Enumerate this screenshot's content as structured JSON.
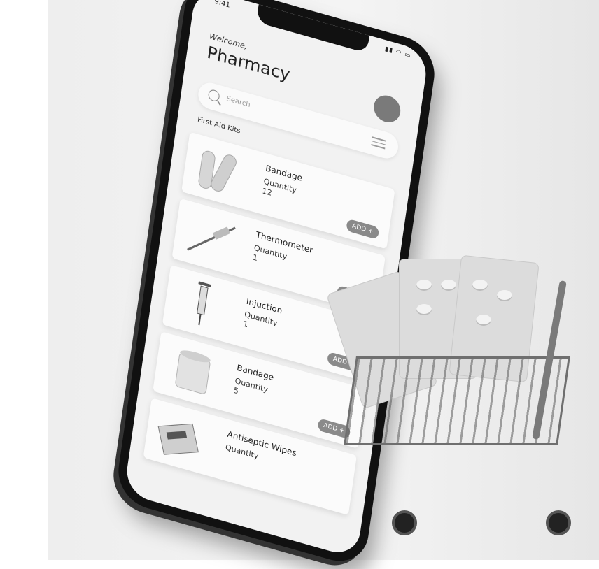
{
  "status": {
    "time": "9:41",
    "icons": "signal-wifi-battery"
  },
  "header": {
    "welcome": "Welcome,",
    "title": "Pharmacy"
  },
  "search": {
    "placeholder": "Search"
  },
  "section": {
    "title": "First Aid Kits"
  },
  "products": [
    {
      "name": "Bandage",
      "qty_label": "Quantity",
      "qty": "12",
      "add": "ADD +"
    },
    {
      "name": "Thermometer",
      "qty_label": "Quantity",
      "qty": "1",
      "add": "ADD +"
    },
    {
      "name": "Injuction",
      "qty_label": "Quantity",
      "qty": "1",
      "add": "ADD +"
    },
    {
      "name": "Bandage",
      "qty_label": "Quantity",
      "qty": "5",
      "add": "ADD +"
    },
    {
      "name": "Antiseptic Wipes",
      "qty_label": "Quantity"
    }
  ],
  "colors": {
    "screen_bg": "#f2f2f2",
    "button": "#8a8a8a",
    "avatar": "#7a7a7a"
  }
}
